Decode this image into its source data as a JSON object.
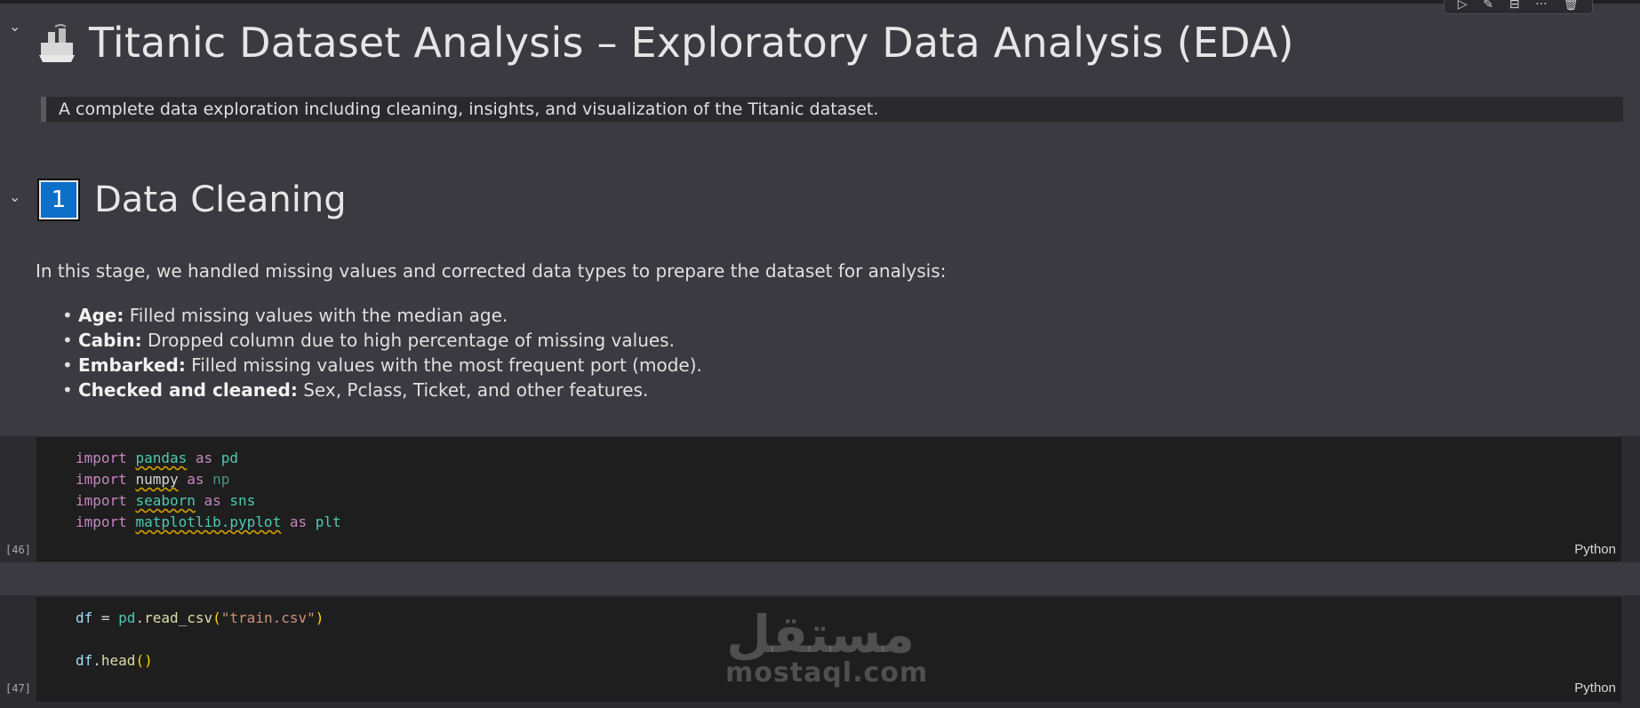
{
  "toolbar": {
    "icons": [
      "run-icon",
      "edit-icon",
      "split-cell-icon",
      "more-icon",
      "delete-icon"
    ],
    "glyphs": [
      "▷",
      "✎",
      "⊟",
      "···",
      "🗑"
    ]
  },
  "title": {
    "text": "Titanic Dataset Analysis – Exploratory Data Analysis (EDA)",
    "icon": "ship-icon"
  },
  "subtitle": "A complete data exploration including cleaning, insights, and visualization of the Titanic dataset.",
  "section1": {
    "number": "1",
    "title": "Data Cleaning",
    "intro": "In this stage, we handled missing values and corrected data types to prepare the dataset for analysis:",
    "bullets": [
      {
        "label": "Age:",
        "text": " Filled missing values with the median age."
      },
      {
        "label": "Cabin:",
        "text": " Dropped column due to high percentage of missing values."
      },
      {
        "label": "Embarked:",
        "text": " Filled missing values with the most frequent port (mode)."
      },
      {
        "label": "Checked and cleaned:",
        "text": " Sex, Pclass, Ticket, and other features."
      }
    ]
  },
  "cells": [
    {
      "exec_count": "[46]",
      "language": "Python",
      "lines": [
        {
          "kw": "import",
          "mod": "pandas",
          "as": "as",
          "alias": "pd"
        },
        {
          "kw": "import",
          "mod": "numpy",
          "as": "as",
          "alias": "np"
        },
        {
          "kw": "import",
          "mod": "seaborn",
          "as": "as",
          "alias": "sns"
        },
        {
          "kw": "import",
          "mod": "matplotlib.pyplot",
          "as": "as",
          "alias": "plt"
        }
      ]
    },
    {
      "exec_count": "[47]",
      "language": "Python",
      "line1": {
        "var": "df",
        "eq": " = ",
        "obj": "pd",
        "dot": ".",
        "fn": "read_csv",
        "open": "(",
        "str": "\"train.csv\"",
        "close": ")"
      },
      "line2": {
        "var": "df",
        "dot": ".",
        "fn": "head",
        "parens": "()"
      }
    }
  ],
  "watermark": {
    "arabic": "مستقل",
    "latin": "mostaql.com"
  }
}
